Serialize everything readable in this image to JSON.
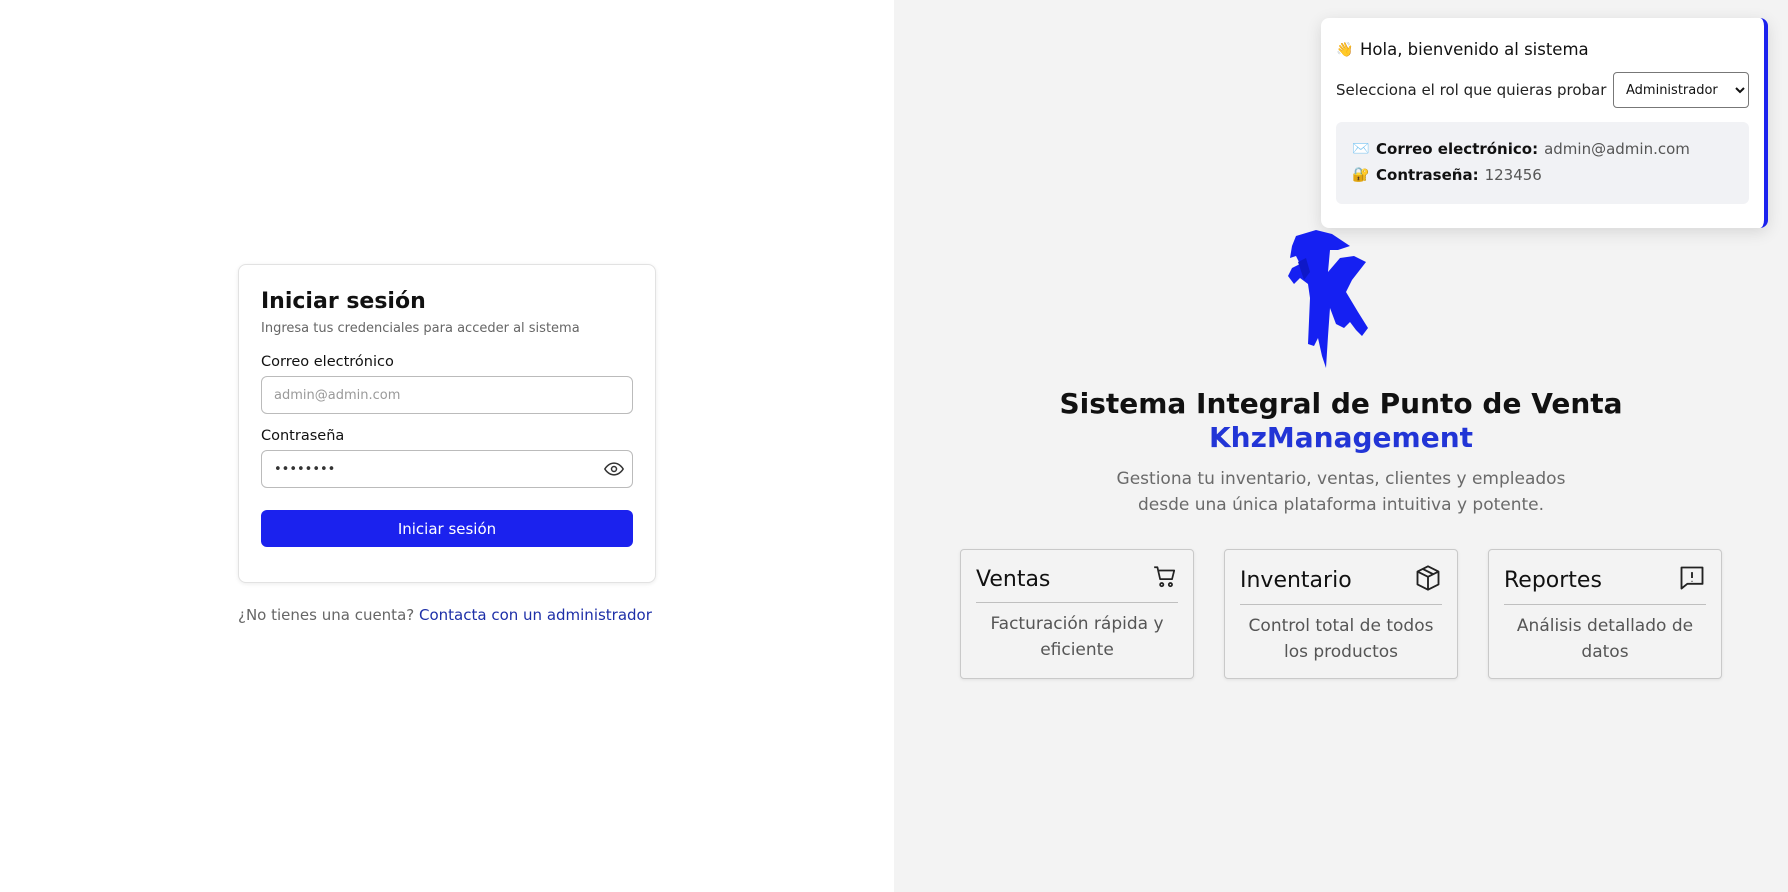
{
  "login": {
    "title": "Iniciar sesión",
    "subtitle": "Ingresa tus credenciales para acceder al sistema",
    "email_label": "Correo electrónico",
    "email_placeholder": "admin@admin.com",
    "password_label": "Contraseña",
    "password_value": "••••••••",
    "submit_label": "Iniciar sesión",
    "eye_icon": "eye-icon"
  },
  "signup": {
    "question": "¿No tienes una cuenta?",
    "link": "Contacta con un administrador"
  },
  "role_panel": {
    "wave_emoji": "👋",
    "greeting": "Hola, bienvenido al sistema",
    "role_label": "Selecciona el rol que quieras probar",
    "role_selected": "Administrador",
    "email_emoji": "✉️",
    "email_key": "Correo electrónico:",
    "email_value": "admin@admin.com",
    "lock_emoji": "🔐",
    "password_key": "Contraseña:",
    "password_value": "123456"
  },
  "hero": {
    "title": "Sistema Integral de Punto de Venta",
    "brand": "KhzManagement",
    "description": "Gestiona tu inventario, ventas, clientes y empleados desde una única plataforma intuitiva y potente."
  },
  "features": [
    {
      "title": "Ventas",
      "description": "Facturación rápida y eficiente",
      "icon": "cart-icon"
    },
    {
      "title": "Inventario",
      "description": "Control total de todos los productos",
      "icon": "box-icon"
    },
    {
      "title": "Reportes",
      "description": "Análisis detallado de datos",
      "icon": "report-icon"
    }
  ],
  "colors": {
    "accent": "#1b22ee",
    "brand_text": "#2235d6",
    "link": "#1d2fa8",
    "right_bg": "#f3f3f3"
  }
}
